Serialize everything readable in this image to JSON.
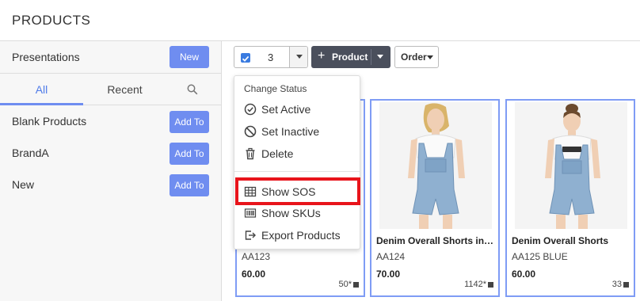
{
  "header": {
    "title": "PRODUCTS"
  },
  "sidebar": {
    "presentations_label": "Presentations",
    "new_button": "New",
    "tabs": [
      {
        "label": "All"
      },
      {
        "label": "Recent"
      }
    ],
    "items": [
      {
        "label": "Blank Products",
        "button": "Add To"
      },
      {
        "label": "BrandA",
        "button": "Add To"
      },
      {
        "label": "New",
        "button": "Add To"
      }
    ]
  },
  "toolbar": {
    "selected_count": "3",
    "product_label": "Product",
    "order_label": "Order"
  },
  "dropdown": {
    "header": "Change Status",
    "items": [
      {
        "label": "Set Active",
        "icon": "check-circle-icon"
      },
      {
        "label": "Set Inactive",
        "icon": "ban-icon"
      },
      {
        "label": "Delete",
        "icon": "trash-icon"
      },
      {
        "label": "Show SOS",
        "icon": "table-icon"
      },
      {
        "label": "Show SKUs",
        "icon": "barcode-icon"
      },
      {
        "label": "Export Products",
        "icon": "export-icon"
      }
    ]
  },
  "products": [
    {
      "name": "",
      "sku": "AA123",
      "price": "60.00",
      "stock": "50*"
    },
    {
      "name": "Denim Overall Shorts in Vi...",
      "sku": "AA124",
      "price": "70.00",
      "stock": "1142*"
    },
    {
      "name": "Denim Overall Shorts",
      "sku": "AA125 BLUE",
      "price": "60.00",
      "stock": "33"
    }
  ],
  "colors": {
    "accent": "#6f8df0",
    "highlight": "#e8141b",
    "card_border": "#7f9cf5"
  }
}
